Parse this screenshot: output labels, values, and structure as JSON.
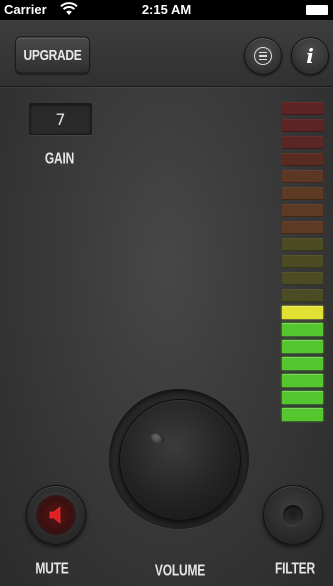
{
  "status_bar": {
    "carrier": "Carrier",
    "time": "2:15 AM"
  },
  "toolbar": {
    "upgrade_label": "UPGRADE",
    "info_label": "i"
  },
  "gain": {
    "value": "7",
    "label": "GAIN"
  },
  "controls": {
    "mute_label": "MUTE",
    "volume_label": "VOLUME",
    "filter_label": "FILTER"
  },
  "level_meter": {
    "active_segments": 7,
    "segments": [
      {
        "color": "#5e2424",
        "lit": false
      },
      {
        "color": "#5e2424",
        "lit": false
      },
      {
        "color": "#5a2626",
        "lit": false
      },
      {
        "color": "#5a2c20",
        "lit": false
      },
      {
        "color": "#5c3824",
        "lit": false
      },
      {
        "color": "#5c3a24",
        "lit": false
      },
      {
        "color": "#5c3a24",
        "lit": false
      },
      {
        "color": "#5c3a24",
        "lit": false
      },
      {
        "color": "#4c4c24",
        "lit": false
      },
      {
        "color": "#4c4c24",
        "lit": false
      },
      {
        "color": "#4c4c24",
        "lit": false
      },
      {
        "color": "#4c4c24",
        "lit": false
      },
      {
        "color": "#e1e134",
        "lit": true
      },
      {
        "color": "#55c72e",
        "lit": true
      },
      {
        "color": "#55c72e",
        "lit": true
      },
      {
        "color": "#55c72e",
        "lit": true
      },
      {
        "color": "#55c72e",
        "lit": true
      },
      {
        "color": "#55c72e",
        "lit": true
      },
      {
        "color": "#55c72e",
        "lit": true
      }
    ]
  },
  "icons": {
    "wifi": "wifi-icon",
    "battery": "battery-icon",
    "menu": "menu-icon",
    "info": "info-icon",
    "mute": "speaker-icon",
    "filter": "filter-icon"
  },
  "colors": {
    "mute_accent": "#d11f1f",
    "background": "#3a3a3a"
  }
}
